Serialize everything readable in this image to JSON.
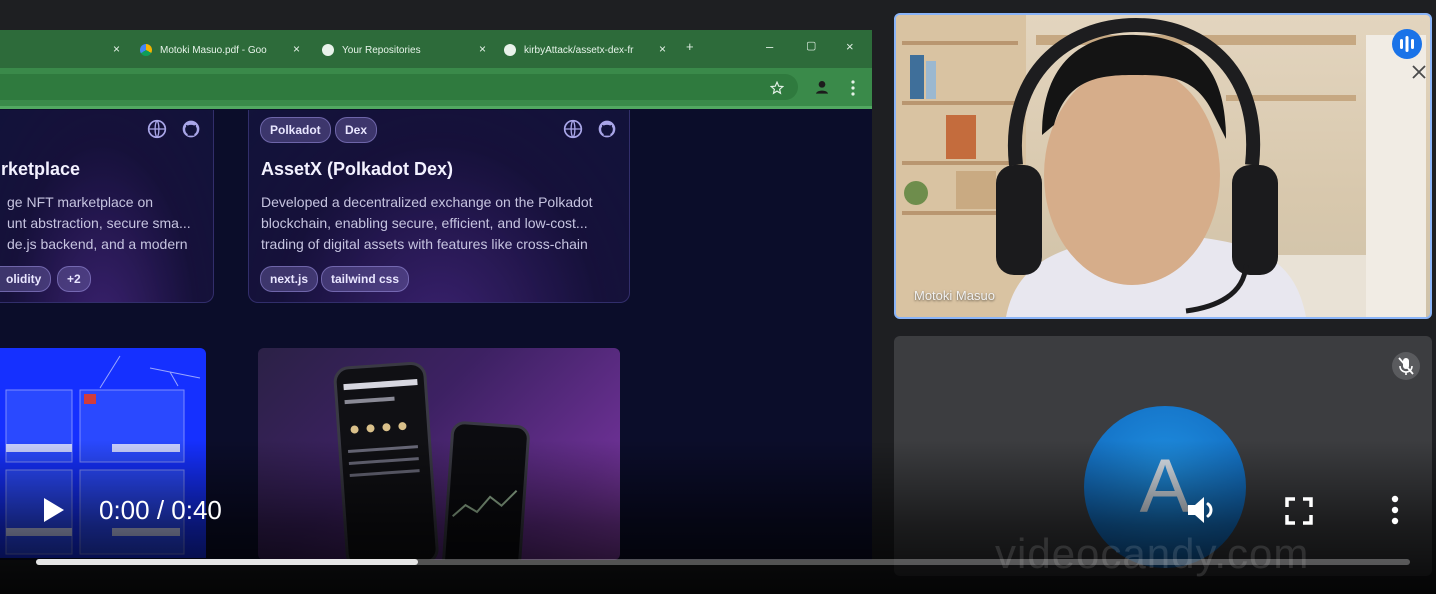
{
  "browser": {
    "tabs": [
      {
        "label": "Motoki Masuo.pdf - Goo"
      },
      {
        "label": "Your Repositories"
      },
      {
        "label": "kirbyAttack/assetx-dex-fr"
      }
    ],
    "new_tab": "+",
    "close_glyph": "×",
    "minimize": "–",
    "restore": "▢",
    "window_close": "×"
  },
  "cards": [
    {
      "title": "rketplace",
      "desc": [
        "ge NFT marketplace on",
        "unt abstraction, secure sma...",
        "de.js backend, and a modern"
      ],
      "tags": [
        "olidity",
        "+2"
      ]
    },
    {
      "top_tags": [
        "Polkadot",
        "Dex"
      ],
      "title": "AssetX (Polkadot Dex)",
      "desc": [
        "Developed a decentralized exchange on the Polkadot",
        "blockchain, enabling secure, efficient, and low-cost...",
        "trading of digital assets with features like cross-chain"
      ],
      "tags": [
        "next.js",
        "tailwind css"
      ]
    }
  ],
  "participants": {
    "video_name": "Motoki Masuo",
    "avatar_letter": "A"
  },
  "player": {
    "time": "0:00 / 0:40",
    "progress_fraction": 0.278,
    "watermark": "videocandy.com"
  },
  "colors": {
    "speaking_blue": "#1a73e8",
    "avatar_blue": "#1a7fd6",
    "browser_green": "#2d6b3a"
  }
}
